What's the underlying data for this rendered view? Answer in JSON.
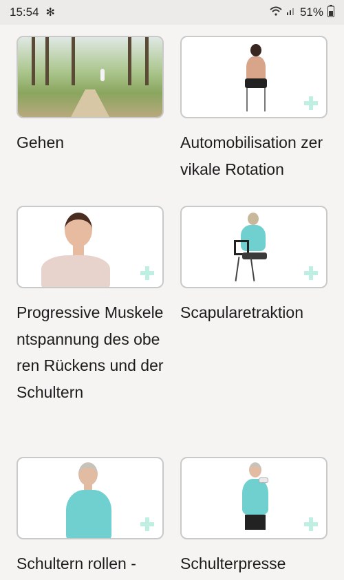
{
  "status": {
    "time": "15:54",
    "battery": "51%"
  },
  "exercises": [
    {
      "title": "Gehen"
    },
    {
      "title": "Automobilisation zervikale Rotation"
    },
    {
      "title": "Progressive Muskelentspannung des oberen Rückens und der Schultern"
    },
    {
      "title": "Scapularetraktion"
    },
    {
      "title": "Schultern rollen -"
    },
    {
      "title": "Schulterpresse"
    }
  ],
  "colors": {
    "accent_plus": "#bfeee3",
    "card_border": "#c9c9c9",
    "background": "#f5f4f2"
  }
}
